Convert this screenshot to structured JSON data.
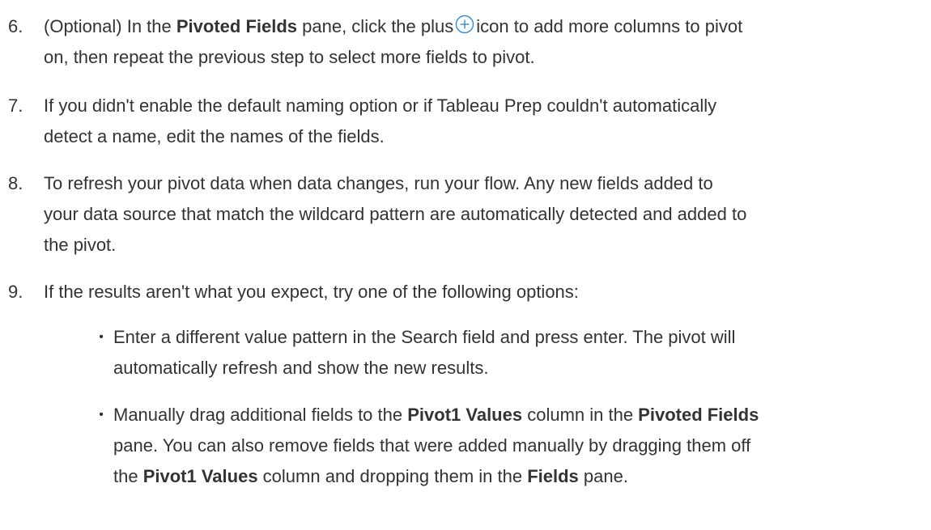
{
  "steps": [
    {
      "number": "6.",
      "lines": [
        {
          "parts": [
            "(Optional) In the ",
            "Pivoted Fields",
            " pane, click the plus",
            "icon to add more columns to pivot"
          ]
        },
        {
          "text": "on, then repeat the previous step to select more fields to pivot."
        }
      ],
      "icon": "plus-circle-icon",
      "icon_color": "#2E8BD6"
    },
    {
      "number": "7.",
      "lines": [
        {
          "text": "If you didn't enable the default naming option or if Tableau Prep couldn't automatically"
        },
        {
          "text": "detect a name, edit the names of the fields."
        }
      ]
    },
    {
      "number": "8.",
      "lines": [
        {
          "text": "To refresh your pivot data when data changes, run your flow. Any new fields added to"
        },
        {
          "text": "your data source that match the wildcard pattern are automatically detected and added to"
        },
        {
          "text": "the pivot."
        }
      ]
    },
    {
      "number": "9.",
      "lines": [
        {
          "text": "If the results aren't what you expect, try one of the following options:"
        }
      ]
    }
  ],
  "bullets": [
    {
      "symbol": "•",
      "lines": [
        {
          "text": "Enter a different value pattern in the Search field and press enter. The pivot will"
        },
        {
          "text": "automatically refresh and show the new results."
        }
      ]
    },
    {
      "symbol": "•",
      "lines": [
        {
          "parts": [
            "Manually drag additional fields to the ",
            "Pivot1 Values",
            " column in the ",
            "Pivoted Fields"
          ]
        },
        {
          "text": "pane. You can also remove fields that were added manually by dragging them off"
        },
        {
          "parts": [
            "the ",
            "Pivot1 Values",
            " column and dropping them in the ",
            "Fields",
            " pane."
          ]
        }
      ]
    }
  ],
  "colors": {
    "text": "#333333",
    "icon": "#2E8BD6",
    "background": "#FFFFFF"
  }
}
